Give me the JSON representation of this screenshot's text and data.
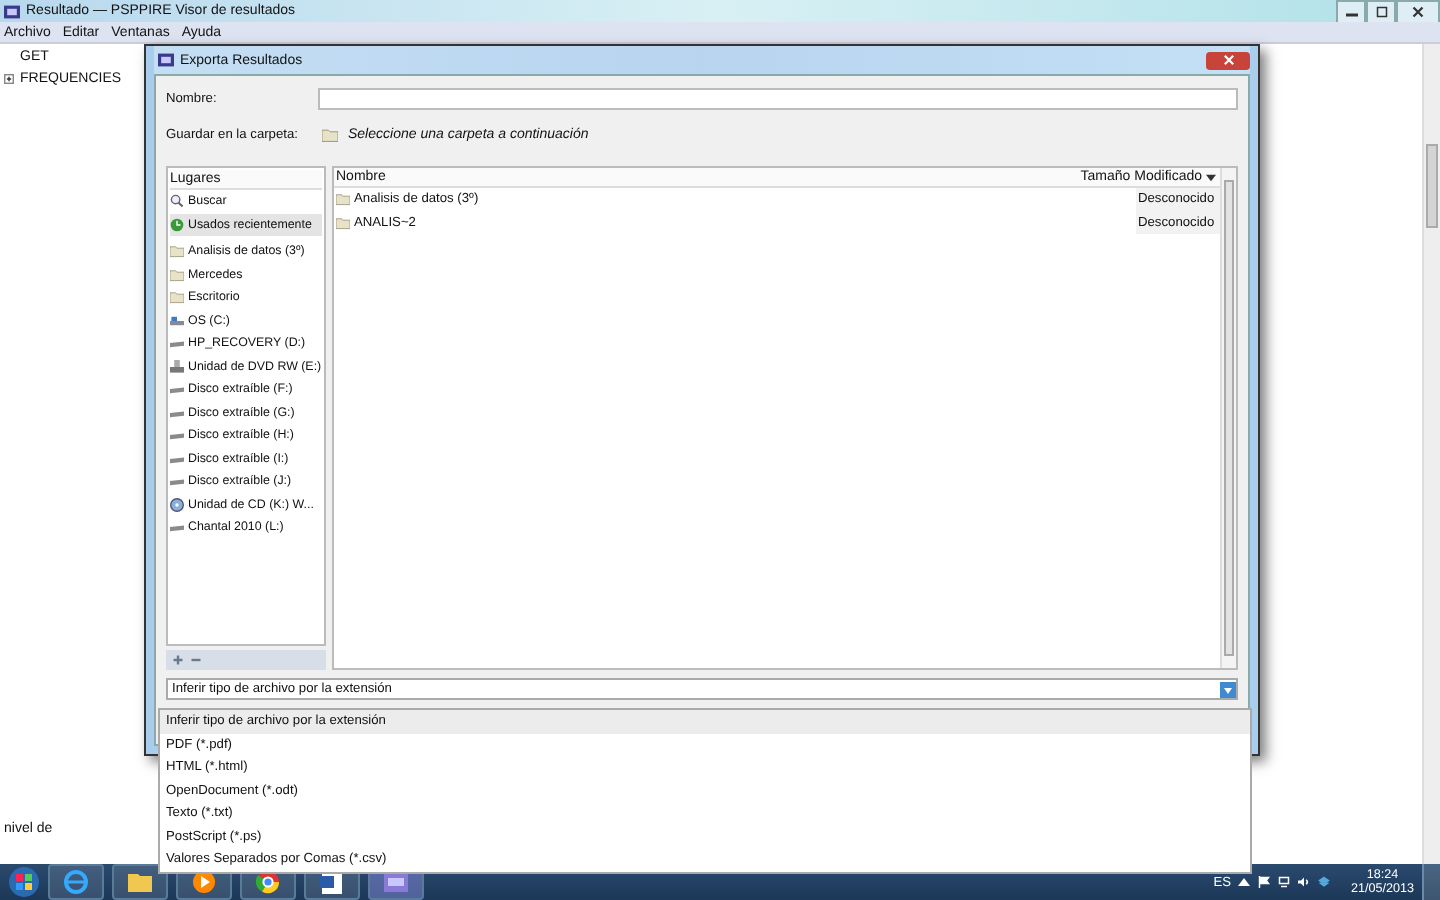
{
  "main_window": {
    "title": "Resultado — PSPPIRE Visor de resultados",
    "menu": [
      "Archivo",
      "Editar",
      "Ventanas",
      "Ayuda"
    ],
    "tree": [
      {
        "label": "GET",
        "expandable": false
      },
      {
        "label": "FREQUENCIES",
        "expandable": true
      }
    ],
    "hidden_text": "nivel de"
  },
  "dialog": {
    "title": "Exporta Resultados",
    "name_label": "Nombre:",
    "folder_label": "Guardar en la carpeta:",
    "folder_hint": "Seleccione una carpeta a continuación",
    "places_header": "Lugares",
    "places": [
      {
        "label": "Buscar",
        "kind": "search",
        "selected": false
      },
      {
        "label": "Usados recientemente",
        "kind": "recent",
        "selected": true
      },
      {
        "label": "Analisis de datos (3º)",
        "kind": "folder",
        "selected": false
      },
      {
        "label": "Mercedes",
        "kind": "folder",
        "selected": false
      },
      {
        "label": "Escritorio",
        "kind": "folder",
        "selected": false
      },
      {
        "label": "OS (C:)",
        "kind": "disk",
        "selected": false
      },
      {
        "label": "HP_RECOVERY (D:)",
        "kind": "drive",
        "selected": false
      },
      {
        "label": "Unidad de DVD RW (E:)",
        "kind": "dvd",
        "selected": false
      },
      {
        "label": "Disco extraíble (F:)",
        "kind": "drive",
        "selected": false
      },
      {
        "label": "Disco extraíble (G:)",
        "kind": "drive",
        "selected": false
      },
      {
        "label": "Disco extraíble (H:)",
        "kind": "drive",
        "selected": false
      },
      {
        "label": "Disco extraíble (I:)",
        "kind": "drive",
        "selected": false
      },
      {
        "label": "Disco extraíble (J:)",
        "kind": "drive",
        "selected": false
      },
      {
        "label": "Unidad de CD (K:) W...",
        "kind": "cd",
        "selected": false
      },
      {
        "label": "Chantal 2010 (L:)",
        "kind": "drive",
        "selected": false
      }
    ],
    "columns": [
      "Nombre",
      "Tamaño",
      "Modificado"
    ],
    "files": [
      {
        "name": "Analisis de datos (3º)",
        "modified": "Desconocido"
      },
      {
        "name": "ANALIS~2",
        "modified": "Desconocido"
      }
    ],
    "filetype": "Inferir tipo de archivo por la extensión",
    "filetype_options": [
      {
        "label": "Inferir tipo de archivo por la extensión",
        "selected": true
      },
      {
        "label": "PDF (*.pdf)",
        "selected": false
      },
      {
        "label": "HTML (*.html)",
        "selected": false
      },
      {
        "label": "OpenDocument (*.odt)",
        "selected": false
      },
      {
        "label": "Texto (*.txt)",
        "selected": false
      },
      {
        "label": "PostScript (*.ps)",
        "selected": false
      },
      {
        "label": "Valores Separados por Comas (*.csv)",
        "selected": false
      }
    ]
  },
  "taskbar": {
    "language": "ES",
    "time": "18:24",
    "date": "21/05/2013"
  }
}
